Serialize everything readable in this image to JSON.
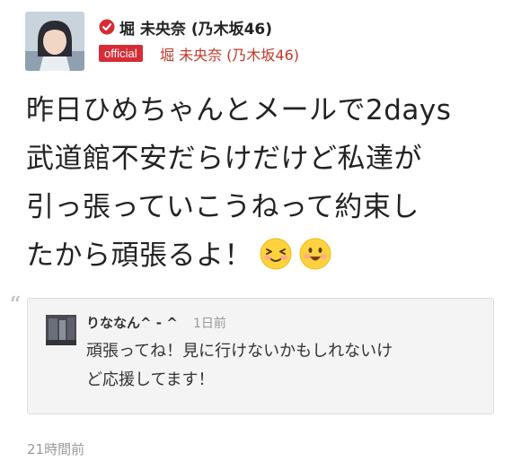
{
  "author": {
    "name": "堀 未央奈 (乃木坂46)",
    "badge": "official",
    "official_name": "堀 未央奈 (乃木坂46)",
    "avatar": "profile-photo",
    "verified_icon": "verified-check-icon"
  },
  "post": {
    "lines": [
      "昨日ひめちゃんとメールで2days",
      "武道館不安だらけだけど私達が",
      "引っ張っていこうねって約束し",
      "たから頑張るよ！"
    ],
    "emojis": [
      "grinning-squint-face-emoji",
      "smiling-face-emoji"
    ],
    "time": "21時間前"
  },
  "comment": {
    "quote_icon": "“",
    "user": "りななん^ - ^",
    "time": "1日前",
    "lines": [
      "頑張ってね！見に行けないかもしれないけ",
      "ど応援してます！"
    ]
  },
  "colors": {
    "accent": "#d62c35",
    "official_text": "#c0392b",
    "muted": "#999999",
    "comment_bg": "#f4f4f4"
  }
}
